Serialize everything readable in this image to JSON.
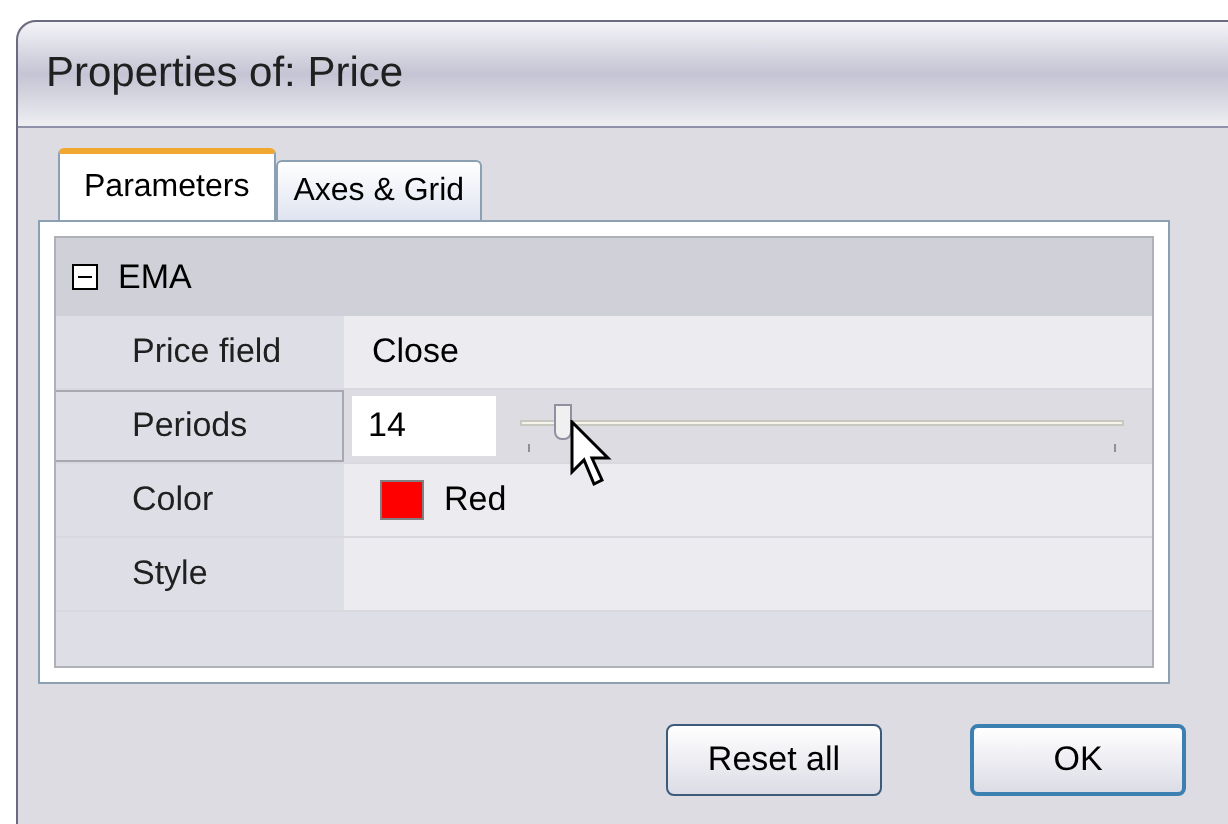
{
  "window": {
    "title": "Properties of: Price"
  },
  "tabs": [
    {
      "label": "Parameters",
      "selected": true
    },
    {
      "label": "Axes & Grid",
      "selected": false
    }
  ],
  "group": {
    "title": "EMA",
    "expanded": true
  },
  "properties": [
    {
      "kind": "text",
      "label": "Price field",
      "value": "Close",
      "selected": false
    },
    {
      "kind": "slider",
      "label": "Periods",
      "value": "14",
      "level": 0.07,
      "selected": true
    },
    {
      "kind": "color",
      "label": "Color",
      "value": "Red",
      "color": "#ff0000",
      "selected": false
    },
    {
      "kind": "empty",
      "label": "Style",
      "selected": false
    }
  ],
  "buttons": [
    {
      "label": "Reset all",
      "default": false
    },
    {
      "label": "OK",
      "default": true
    }
  ]
}
